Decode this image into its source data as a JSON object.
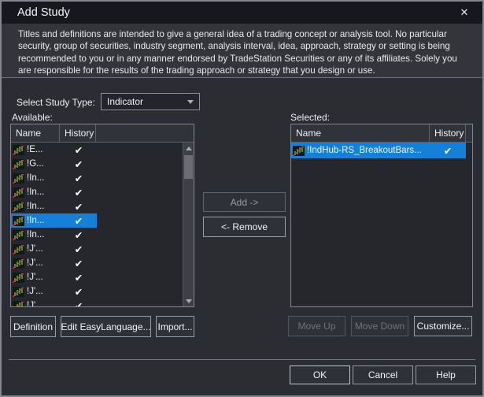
{
  "window": {
    "title": "Add Study",
    "close_glyph": "✕"
  },
  "disclaimer": "Titles and definitions are intended to give a general idea of a trading concept or analysis tool. No particular security, group of securities, industry segment, analysis interval, idea, approach, strategy or setting is being recommended to you or in any manner endorsed by TradeStation Securities or any of its affiliates. Solely you are responsible for the results of the trading approach or strategy that you design or use.",
  "study_type": {
    "label": "Select Study Type:",
    "value": "Indicator"
  },
  "available": {
    "label": "Available:",
    "columns": {
      "name": "Name",
      "history": "History"
    },
    "items": [
      {
        "name": "!E...",
        "history": "✔",
        "selected": false
      },
      {
        "name": "!G...",
        "history": "✔",
        "selected": false
      },
      {
        "name": "!In...",
        "history": "✔",
        "selected": false
      },
      {
        "name": "!In...",
        "history": "✔",
        "selected": false
      },
      {
        "name": "!In...",
        "history": "✔",
        "selected": false
      },
      {
        "name": "!In...",
        "history": "✔",
        "selected": true
      },
      {
        "name": "!In...",
        "history": "✔",
        "selected": false
      },
      {
        "name": "!J'...",
        "history": "✔",
        "selected": false
      },
      {
        "name": "!J'...",
        "history": "✔",
        "selected": false
      },
      {
        "name": "!J'...",
        "history": "✔",
        "selected": false
      },
      {
        "name": "!J'...",
        "history": "✔",
        "selected": false
      },
      {
        "name": "!J'...",
        "history": "✔",
        "selected": false
      }
    ]
  },
  "selected_list": {
    "label": "Selected:",
    "columns": {
      "name": "Name",
      "history": "History"
    },
    "items": [
      {
        "name": "!IndHub-RS_BreakoutBars...",
        "history": "✔",
        "selected": true
      }
    ]
  },
  "transfer": {
    "add": "Add ->",
    "remove": "<- Remove"
  },
  "available_actions": {
    "definition": "Definition",
    "edit_easylanguage": "Edit EasyLanguage...",
    "import": "Import..."
  },
  "selected_actions": {
    "move_up": "Move Up",
    "move_down": "Move Down",
    "customize": "Customize..."
  },
  "footer": {
    "ok": "OK",
    "cancel": "Cancel",
    "help": "Help"
  },
  "colors": {
    "selection_blue": "#1580d8",
    "dialog_bg": "#2b2d33",
    "titlebar_bg": "#17181d",
    "list_bg": "#26272d",
    "candle_green": "#2fbf3a",
    "candle_red": "#e03636",
    "check_white": "#ffffff"
  }
}
